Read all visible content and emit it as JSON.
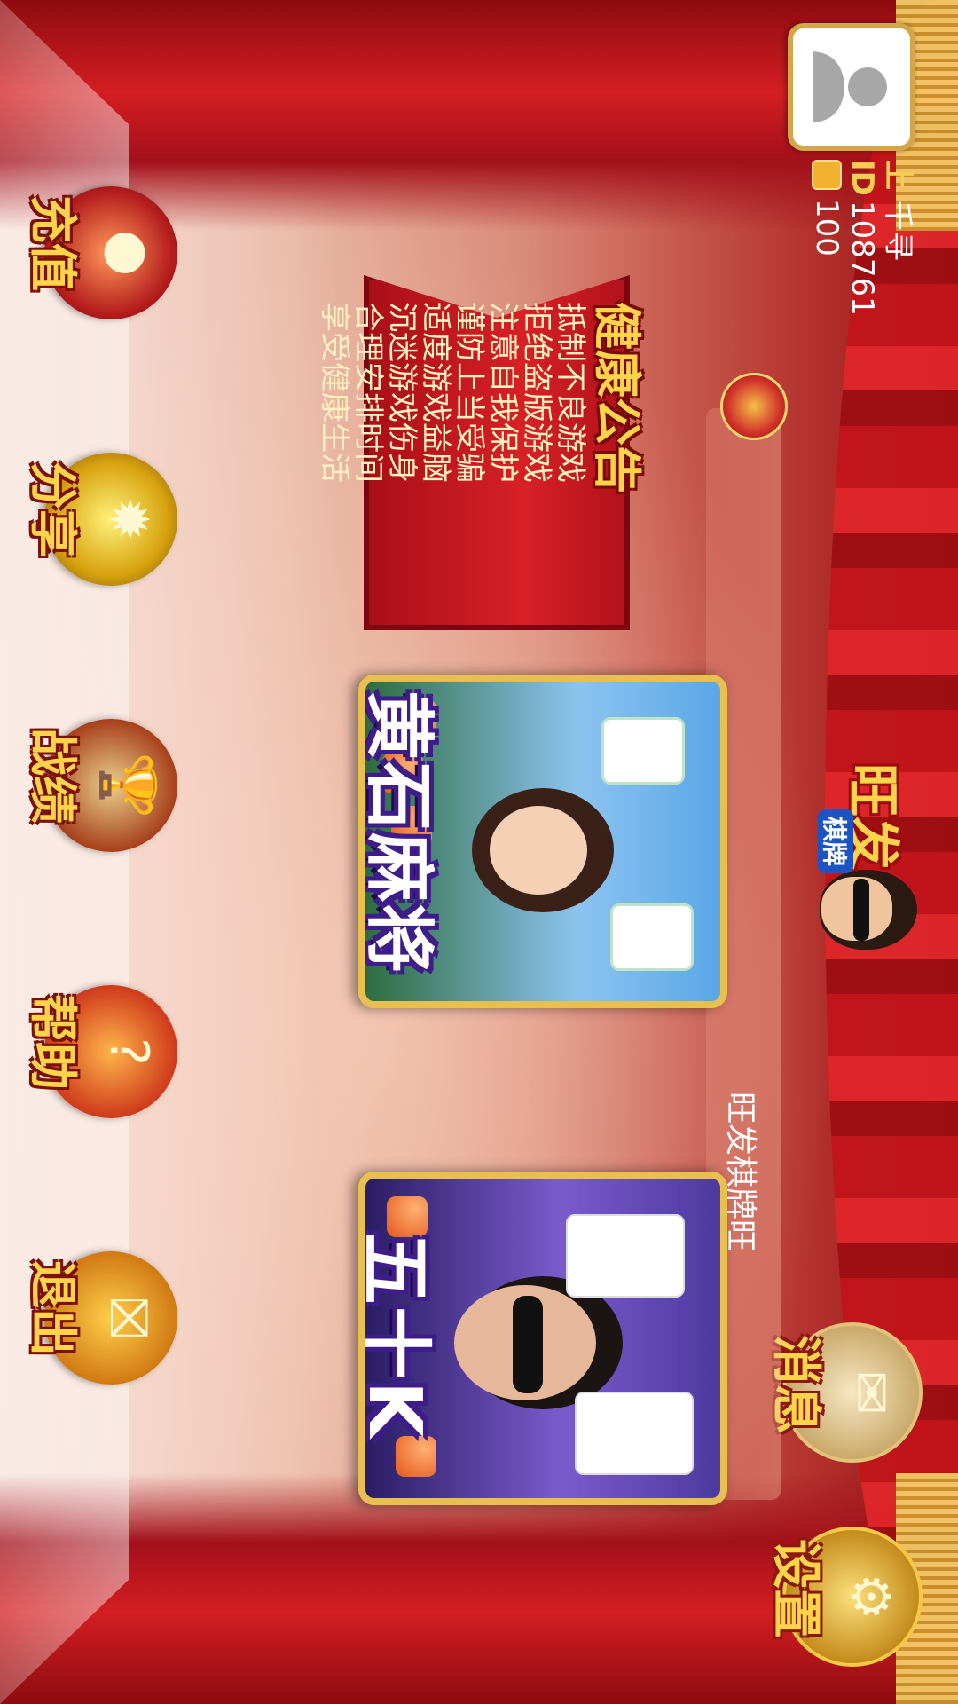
{
  "user": {
    "name_label": "上",
    "name": "千寻",
    "id_label": "ID",
    "id": "108761",
    "coin_label": "房卡",
    "coins": "100"
  },
  "top_buttons": {
    "settings": "设置",
    "message": "消息",
    "message_icon": "scroll-icon",
    "settings_icon": "gear-icon"
  },
  "logo": {
    "title": "旺发",
    "subtitle": "棋牌"
  },
  "marquee": {
    "text": "旺发棋牌旺"
  },
  "notice": {
    "title": "健康公告",
    "lines": [
      "抵制不良游戏",
      "拒绝盗版游戏",
      "注意自我保护",
      "谨防上当受骗",
      "适度游戏益脑",
      "沉迷游戏伤身",
      "合理安排时间",
      "享受健康生活"
    ]
  },
  "games": [
    {
      "title": "黄石麻将",
      "icon": "mahjong-card"
    },
    {
      "title": "五十K",
      "icon": "poker-card"
    }
  ],
  "bottom_nav": [
    {
      "label": "退出",
      "icon": "exit-icon"
    },
    {
      "label": "帮助",
      "icon": "help-icon"
    },
    {
      "label": "战绩",
      "icon": "trophy-icon"
    },
    {
      "label": "分享",
      "icon": "share-icon"
    },
    {
      "label": "充值",
      "icon": "recharge-icon"
    }
  ],
  "colors": {
    "accent_gold": "#ffd34a",
    "curtain_red": "#d41e22",
    "card_border": "#e9c04f"
  }
}
